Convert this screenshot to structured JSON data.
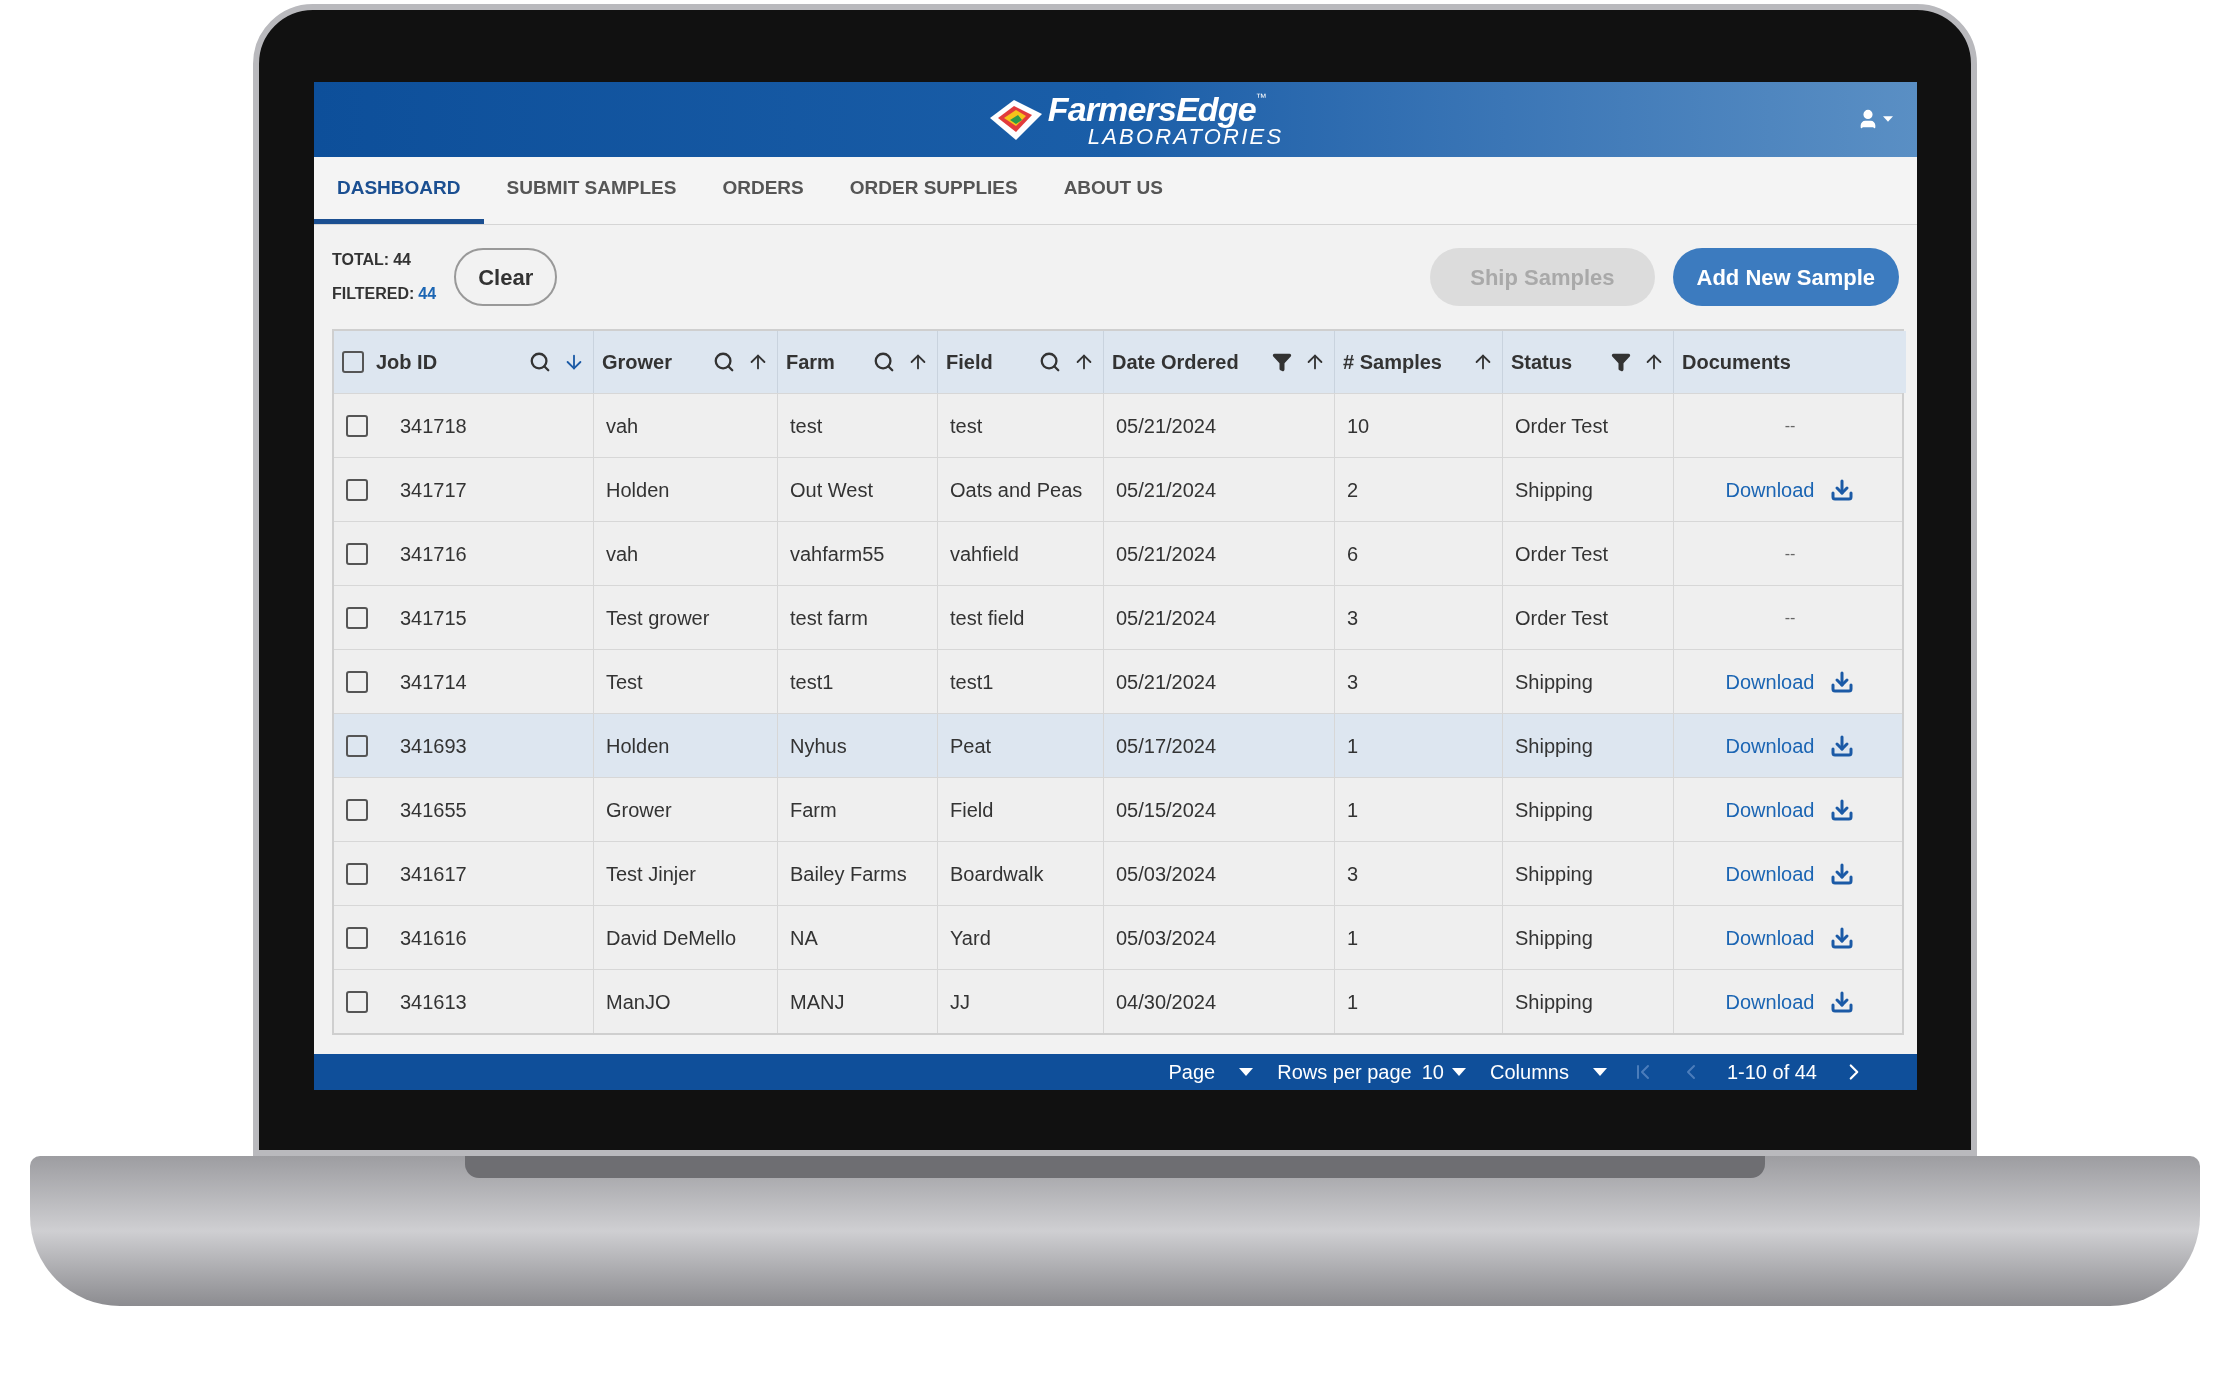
{
  "header": {
    "brand": "FarmersEdge",
    "trademark": "™",
    "subbrand": "LABORATORIES"
  },
  "tabs": [
    {
      "label": "DASHBOARD",
      "selected": true
    },
    {
      "label": "SUBMIT SAMPLES",
      "selected": false
    },
    {
      "label": "ORDERS",
      "selected": false
    },
    {
      "label": "ORDER SUPPLIES",
      "selected": false
    },
    {
      "label": "ABOUT US",
      "selected": false
    }
  ],
  "counts": {
    "total_label": "TOTAL:",
    "total": "44",
    "filtered_label": "FILTERED:",
    "filtered": "44"
  },
  "buttons": {
    "clear": "Clear",
    "ship": {
      "label": "Ship Samples",
      "disabled": true
    },
    "add": {
      "label": "Add New Sample",
      "disabled": false
    }
  },
  "table": {
    "header_checked": false,
    "columns": [
      {
        "label": "Job ID",
        "search": true,
        "filter": false,
        "sortable": true,
        "sort_desc": true
      },
      {
        "label": "Grower",
        "search": true,
        "filter": false,
        "sortable": true,
        "sort_desc": false
      },
      {
        "label": "Farm",
        "search": true,
        "filter": false,
        "sortable": true,
        "sort_desc": false
      },
      {
        "label": "Field",
        "search": true,
        "filter": false,
        "sortable": true,
        "sort_desc": false
      },
      {
        "label": "Date Ordered",
        "search": false,
        "filter": true,
        "sortable": true,
        "sort_desc": false
      },
      {
        "label": "# Samples",
        "search": false,
        "filter": false,
        "sortable": true,
        "sort_desc": false
      },
      {
        "label": "Status",
        "search": false,
        "filter": true,
        "sortable": true,
        "sort_desc": false
      },
      {
        "label": "Documents",
        "search": false,
        "filter": false,
        "sortable": false
      }
    ],
    "rows": [
      {
        "checked": false,
        "highlighted": false,
        "cells": [
          "341718",
          "vah",
          "test",
          "test",
          "05/21/2024",
          "10",
          "Order Test"
        ],
        "document": {
          "kind": "none",
          "label": "--"
        }
      },
      {
        "checked": false,
        "highlighted": false,
        "cells": [
          "341717",
          "Holden",
          "Out West",
          "Oats and Peas",
          "05/21/2024",
          "2",
          "Shipping"
        ],
        "document": {
          "kind": "download",
          "label": "Download"
        }
      },
      {
        "checked": false,
        "highlighted": false,
        "cells": [
          "341716",
          "vah",
          "vahfarm55",
          "vahfield",
          "05/21/2024",
          "6",
          "Order Test"
        ],
        "document": {
          "kind": "none",
          "label": "--"
        }
      },
      {
        "checked": false,
        "highlighted": false,
        "cells": [
          "341715",
          "Test grower",
          "test farm",
          "test field",
          "05/21/2024",
          "3",
          "Order Test"
        ],
        "document": {
          "kind": "none",
          "label": "--"
        }
      },
      {
        "checked": false,
        "highlighted": false,
        "cells": [
          "341714",
          "Test",
          "test1",
          "test1",
          "05/21/2024",
          "3",
          "Shipping"
        ],
        "document": {
          "kind": "download",
          "label": "Download"
        }
      },
      {
        "checked": false,
        "highlighted": true,
        "cells": [
          "341693",
          "Holden",
          "Nyhus",
          "Peat",
          "05/17/2024",
          "1",
          "Shipping"
        ],
        "document": {
          "kind": "download",
          "label": "Download"
        }
      },
      {
        "checked": false,
        "highlighted": false,
        "cells": [
          "341655",
          "Grower",
          "Farm",
          "Field",
          "05/15/2024",
          "1",
          "Shipping"
        ],
        "document": {
          "kind": "download",
          "label": "Download"
        }
      },
      {
        "checked": false,
        "highlighted": false,
        "cells": [
          "341617",
          "Test Jinjer",
          "Bailey Farms",
          "Boardwalk",
          "05/03/2024",
          "3",
          "Shipping"
        ],
        "document": {
          "kind": "download",
          "label": "Download"
        }
      },
      {
        "checked": false,
        "highlighted": false,
        "cells": [
          "341616",
          "David DeMello",
          "NA",
          "Yard",
          "05/03/2024",
          "1",
          "Shipping"
        ],
        "document": {
          "kind": "download",
          "label": "Download"
        }
      },
      {
        "checked": false,
        "highlighted": false,
        "cells": [
          "341613",
          "ManJO",
          "MANJ",
          "JJ",
          "04/30/2024",
          "1",
          "Shipping"
        ],
        "document": {
          "kind": "download",
          "label": "Download"
        }
      }
    ]
  },
  "footer": {
    "page": "Page",
    "rows_per_page": "Rows per page",
    "rows_value": "10",
    "columns": "Columns",
    "range": "1-10 of 44",
    "first_disabled": true,
    "prev_disabled": true,
    "next_disabled": false
  }
}
